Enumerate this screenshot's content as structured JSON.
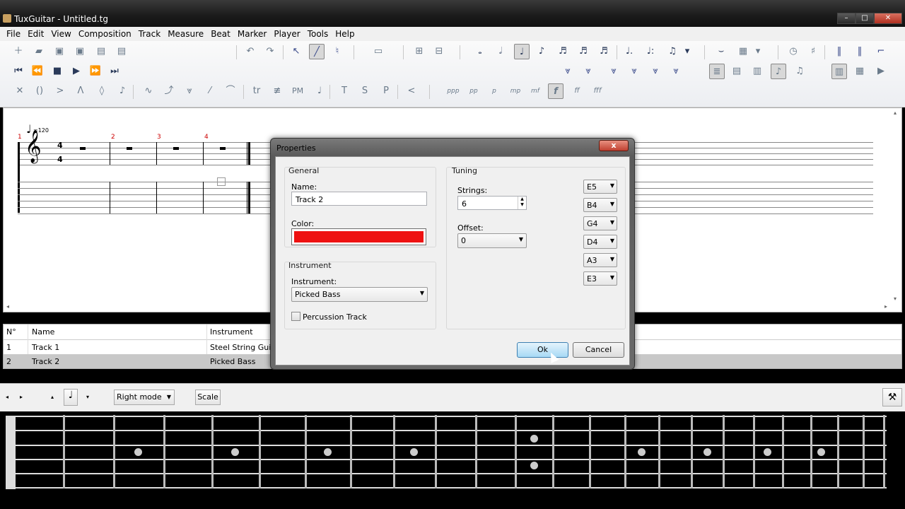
{
  "window": {
    "title": "TuxGuitar - Untitled.tg"
  },
  "menu": [
    "File",
    "Edit",
    "View",
    "Composition",
    "Track",
    "Measure",
    "Beat",
    "Marker",
    "Player",
    "Tools",
    "Help"
  ],
  "score": {
    "tempo": "=120",
    "measures": [
      "1",
      "2",
      "3",
      "4"
    ],
    "time_sig_top": "4",
    "time_sig_bottom": "4"
  },
  "tracks": {
    "headers": {
      "num": "N°",
      "name": "Name",
      "instrument": "Instrument"
    },
    "rows": [
      {
        "num": "1",
        "name": "Track 1",
        "instrument": "Steel String Guitar"
      },
      {
        "num": "2",
        "name": "Track 2",
        "instrument": "Picked Bass"
      }
    ]
  },
  "bottombar": {
    "mode": "Right mode",
    "scale": "Scale"
  },
  "dialog": {
    "title": "Properties",
    "close": "x",
    "general": {
      "label": "General",
      "name_label": "Name:",
      "name_value": "Track 2",
      "color_label": "Color:",
      "color": "#ee1111"
    },
    "instrument": {
      "label": "Instrument",
      "instrument_label": "Instrument:",
      "instrument_value": "Picked Bass",
      "percussion_label": "Percussion Track"
    },
    "tuning": {
      "label": "Tuning",
      "strings_label": "Strings:",
      "strings_value": "6",
      "offset_label": "Offset:",
      "offset_value": "0",
      "notes": [
        "E5",
        "B4",
        "G4",
        "D4",
        "A3",
        "E3"
      ]
    },
    "ok": "Ok",
    "cancel": "Cancel"
  },
  "dynamics": [
    "ppp",
    "pp",
    "p",
    "mp",
    "mf",
    "f",
    "ff",
    "fff"
  ],
  "effects": [
    "tr",
    "PM",
    "T",
    "S",
    "P"
  ]
}
